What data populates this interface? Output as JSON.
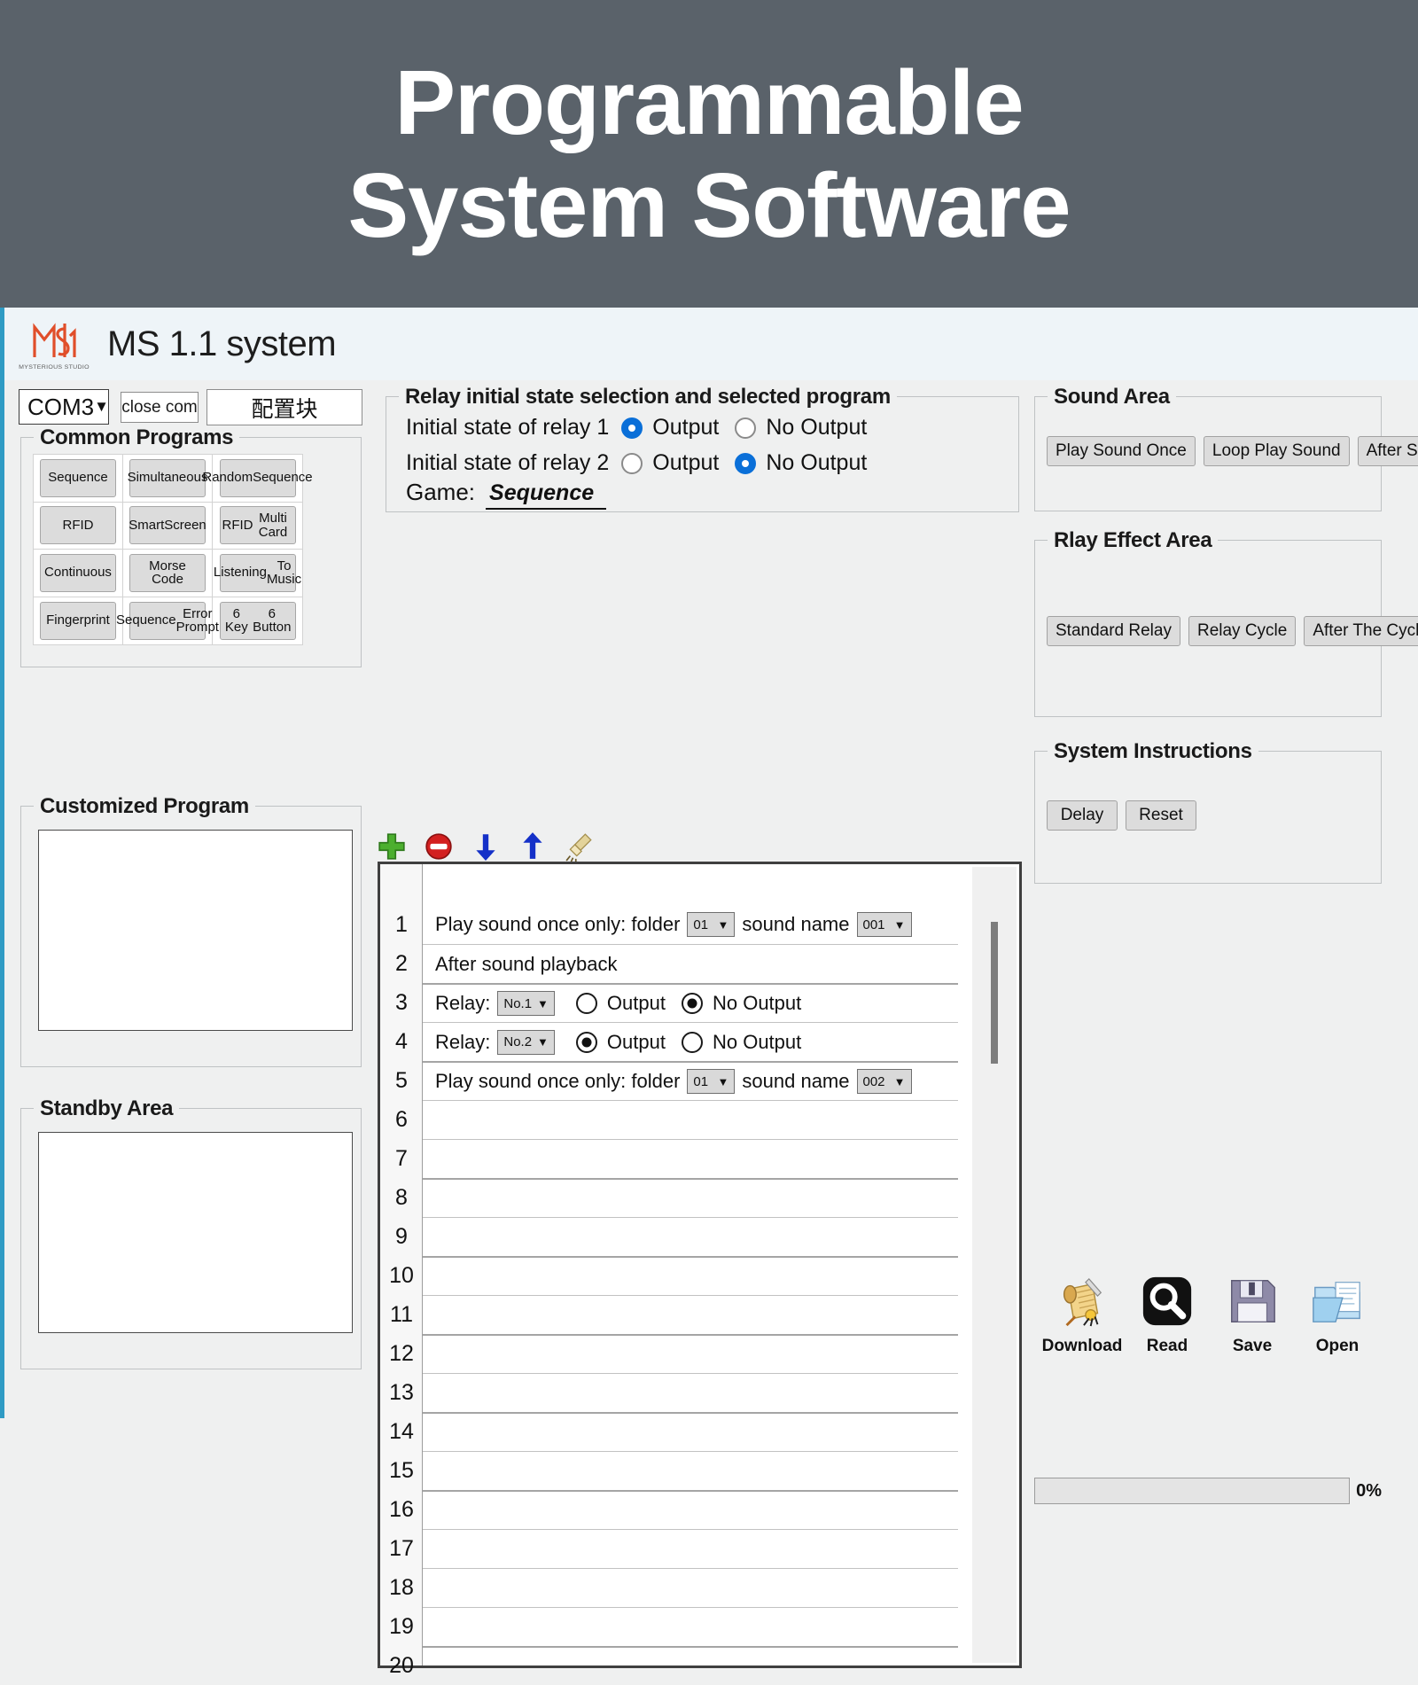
{
  "banner": {
    "line1": "Programmable",
    "line2": "System Software",
    "bg_color": "#5a626a"
  },
  "titlebar": {
    "logo_name": "ms-monogram-logo",
    "logo_subtitle": "MYSTERIOUS STUDIO",
    "logo_color": "#e04e2a",
    "app_title": "MS 1.1 system"
  },
  "connection": {
    "com_port": "COM3",
    "close_com_label": "close com",
    "config_block_label": "配置块"
  },
  "common_programs": {
    "title": "Common Programs",
    "buttons": [
      "Sequence",
      "Simultaneous",
      "Random\nSequence",
      "RFID",
      "Smart\nScreen",
      "RFID\nMulti Card",
      "Continuous",
      "Morse Code",
      "Listening\nTo Music",
      "Fingerprint",
      "Sequence\nError Prompt",
      "6 Key\n6 Button"
    ]
  },
  "customized_program": {
    "title": "Customized Program"
  },
  "standby_area": {
    "title": "Standby Area"
  },
  "relay_panel": {
    "title": "Relay initial state selection and selected program",
    "relay1_label": "Initial state of relay 1",
    "relay1_output_label": "Output",
    "relay1_nooutput_label": "No Output",
    "relay1_selected": "Output",
    "relay2_label": "Initial state of relay 2",
    "relay2_output_label": "Output",
    "relay2_nooutput_label": "No Output",
    "relay2_selected": "No Output",
    "game_label": "Game:",
    "game_value": "Sequence",
    "selected_color": "#0a6fd8"
  },
  "toolbar": {
    "icons": [
      "add-icon",
      "remove-icon",
      "move-down-icon",
      "move-up-icon",
      "clear-broom-icon"
    ]
  },
  "program_list": {
    "row_numbers": [
      "1",
      "2",
      "3",
      "4",
      "5",
      "6",
      "7",
      "8",
      "9",
      "10",
      "11",
      "12",
      "13",
      "14",
      "15",
      "16",
      "17",
      "18",
      "19",
      "20"
    ],
    "rows": [
      {
        "n": "1",
        "type": "play-sound-once",
        "text_before": "Play sound once only: folder",
        "folder": "01",
        "text_middle": "sound name",
        "sound_name": "001"
      },
      {
        "n": "2",
        "type": "after-sound-playback",
        "text_before": "After sound playback"
      },
      {
        "n": "3",
        "type": "relay",
        "text_before": "Relay:",
        "relay_no": "No.1",
        "output_label": "Output",
        "nooutput_label": "No Output",
        "selected": "No Output"
      },
      {
        "n": "4",
        "type": "relay",
        "text_before": "Relay:",
        "relay_no": "No.2",
        "output_label": "Output",
        "nooutput_label": "No Output",
        "selected": "Output"
      },
      {
        "n": "5",
        "type": "play-sound-once",
        "text_before": "Play sound once only: folder",
        "folder": "01",
        "text_middle": "sound name",
        "sound_name": "002"
      }
    ]
  },
  "sound_area": {
    "title": "Sound Area",
    "buttons": [
      "Play Sound Once",
      "Loop Play Sound",
      "After Sound Play"
    ]
  },
  "relay_effect_area": {
    "title": "Rlay Effect Area",
    "buttons": [
      "Standard Relay",
      "Relay Cycle",
      "After The Cycle Relay"
    ]
  },
  "system_instructions": {
    "title": "System Instructions",
    "buttons": [
      "Delay",
      "Reset"
    ]
  },
  "actions": [
    {
      "icon": "scroll-download-icon",
      "label": "Download"
    },
    {
      "icon": "magnifier-read-icon",
      "label": "Read"
    },
    {
      "icon": "floppy-save-icon",
      "label": "Save"
    },
    {
      "icon": "folder-open-icon",
      "label": "Open"
    }
  ],
  "progress": {
    "percent_label": "0%",
    "value": 0
  }
}
